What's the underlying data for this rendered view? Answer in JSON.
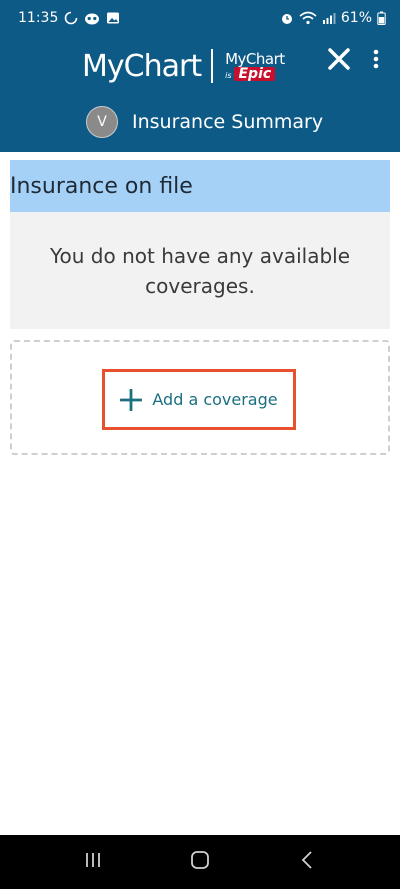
{
  "status_bar": {
    "time": "11:35",
    "battery": "61%",
    "left_icons": [
      "sync-icon",
      "face-icon",
      "image-icon"
    ],
    "right_icons": [
      "alarm-icon",
      "wifi-icon",
      "signal-icon",
      "battery-icon"
    ]
  },
  "header": {
    "brand": "MyChart",
    "partner_top": "MyChart",
    "partner_is": "is",
    "partner_epic": "Epic",
    "avatar_initial": "V",
    "title": "Insurance Summary",
    "close_icon": "close-icon",
    "menu_icon": "more-vertical-icon"
  },
  "insurance": {
    "section_title": "Insurance on file",
    "empty_message": "You do not have any available coverages.",
    "add_label": "Add a coverage",
    "add_icon": "plus-icon"
  },
  "colors": {
    "header_bg": "#0e5a86",
    "section_header_bg": "#a6d1f7",
    "empty_bg": "#f2f2f2",
    "highlight_border": "#e8502e",
    "link_color": "#1a6f80",
    "epic_red": "#c8102e"
  },
  "nav_bar": {
    "icons": [
      "recent-apps-icon",
      "home-icon",
      "back-icon"
    ]
  }
}
